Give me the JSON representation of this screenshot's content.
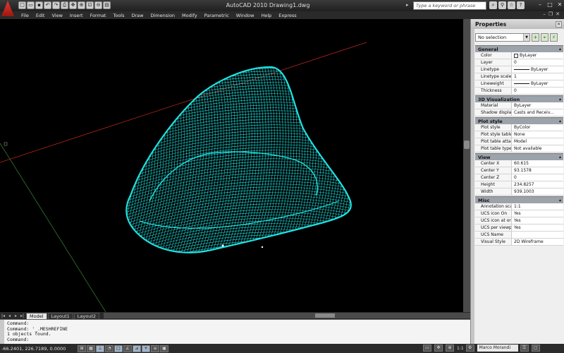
{
  "app": {
    "title": "AutoCAD 2010    Drawing1.dwg",
    "search_placeholder": "Type a keyword or phrase"
  },
  "quick_access": [
    {
      "icon": "new-icon",
      "glyph": "□"
    },
    {
      "icon": "open-icon",
      "glyph": "▭"
    },
    {
      "icon": "save-icon",
      "glyph": "▪"
    },
    {
      "icon": "undo-icon",
      "glyph": "↶"
    },
    {
      "icon": "redo-icon",
      "glyph": "↷"
    },
    {
      "icon": "plot-icon",
      "glyph": "⎙"
    },
    {
      "icon": "pan-icon",
      "glyph": "✥"
    },
    {
      "icon": "zoom-icon",
      "glyph": "⊕"
    },
    {
      "icon": "zoom-window-icon",
      "glyph": "⊡"
    },
    {
      "icon": "zoom-previous-icon",
      "glyph": "⊖"
    },
    {
      "icon": "properties-icon",
      "glyph": "▤"
    }
  ],
  "menu": [
    "File",
    "Edit",
    "View",
    "Insert",
    "Format",
    "Tools",
    "Draw",
    "Dimension",
    "Modify",
    "Parametric",
    "Window",
    "Help",
    "Express"
  ],
  "layout_tabs": [
    {
      "label": "Model",
      "active": true
    },
    {
      "label": "Layout1",
      "active": false
    },
    {
      "label": "Layout2",
      "active": false
    }
  ],
  "command_history": [
    "Command:",
    "Command: '_.MESHREFINE",
    "1 objects found.",
    "Command:"
  ],
  "status": {
    "coordinates": "-66.2401, 226.7189, 0.0000",
    "user": "Marco Morandi",
    "annotation_scale": "1:1"
  },
  "properties": {
    "title": "Properties",
    "selection": "No selection",
    "sections": [
      {
        "name": "General",
        "rows": [
          {
            "label": "Color",
            "value": "ByLayer",
            "kind": "color"
          },
          {
            "label": "Layer",
            "value": "0"
          },
          {
            "label": "Linetype",
            "value": "ByLayer",
            "kind": "line"
          },
          {
            "label": "Linetype scale",
            "value": "1"
          },
          {
            "label": "Lineweight",
            "value": "ByLayer",
            "kind": "line"
          },
          {
            "label": "Thickness",
            "value": "0"
          }
        ]
      },
      {
        "name": "3D Visualization",
        "rows": [
          {
            "label": "Material",
            "value": "ByLayer"
          },
          {
            "label": "Shadow display",
            "value": "Casts and Receiv..."
          }
        ]
      },
      {
        "name": "Plot style",
        "rows": [
          {
            "label": "Plot style",
            "value": "ByColor"
          },
          {
            "label": "Plot style table",
            "value": "None"
          },
          {
            "label": "Plot table attac...",
            "value": "Model"
          },
          {
            "label": "Plot table type",
            "value": "Not available"
          }
        ]
      },
      {
        "name": "View",
        "rows": [
          {
            "label": "Center X",
            "value": "60.615"
          },
          {
            "label": "Center Y",
            "value": "93.1578"
          },
          {
            "label": "Center Z",
            "value": "0"
          },
          {
            "label": "Height",
            "value": "234.8257"
          },
          {
            "label": "Width",
            "value": "939.1003"
          }
        ]
      },
      {
        "name": "Misc",
        "rows": [
          {
            "label": "Annotation scale",
            "value": "1:1"
          },
          {
            "label": "UCS icon On",
            "value": "Yes"
          },
          {
            "label": "UCS icon at origin",
            "value": "Yes"
          },
          {
            "label": "UCS per viewport",
            "value": "Yes"
          },
          {
            "label": "UCS Name",
            "value": ""
          },
          {
            "label": "Visual Style",
            "value": "2D Wireframe"
          }
        ]
      }
    ]
  },
  "colors": {
    "mesh": "#22e0e0",
    "x_axis": "#b3261e",
    "y_axis": "#2f7a2f",
    "viewport_bg": "#000000"
  }
}
